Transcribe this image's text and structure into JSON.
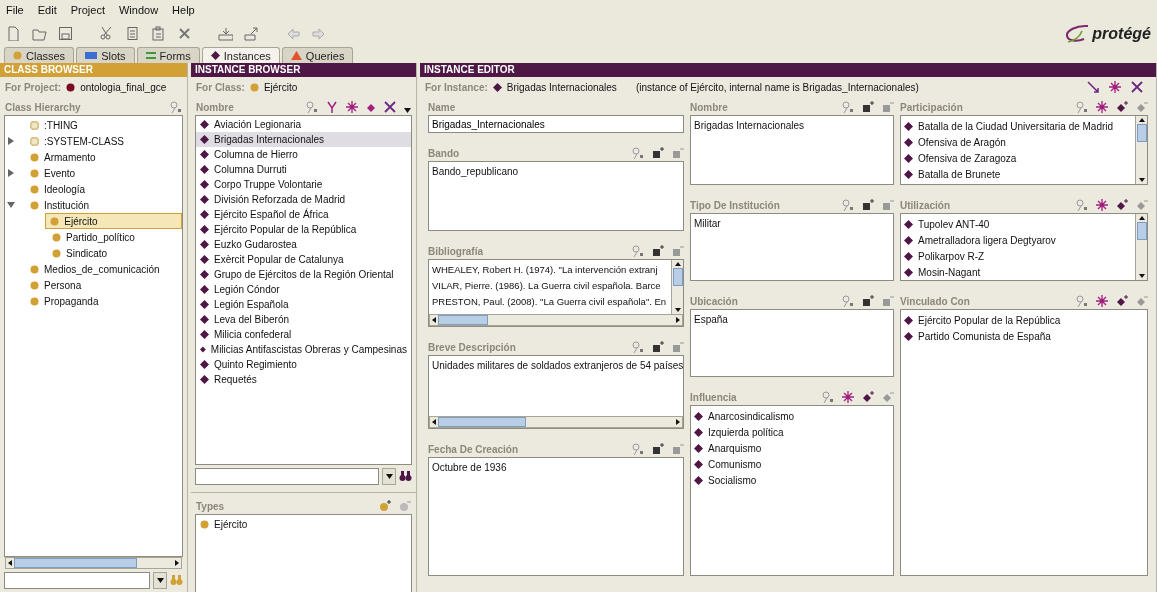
{
  "menu": [
    "File",
    "Edit",
    "Project",
    "Window",
    "Help"
  ],
  "logo": "protégé",
  "tabs": [
    {
      "label": "Classes",
      "kind": "class",
      "selected": false
    },
    {
      "label": "Slots",
      "kind": "slot",
      "selected": false
    },
    {
      "label": "Forms",
      "kind": "form",
      "selected": false
    },
    {
      "label": "Instances",
      "kind": "instance",
      "selected": true
    },
    {
      "label": "Queries",
      "kind": "query",
      "selected": false
    }
  ],
  "class_browser": {
    "title": "CLASS BROWSER",
    "project_label": "For Project:",
    "project": "ontologia_final_gce",
    "hierarchy_label": "Class Hierarchy",
    "tree": [
      {
        "label": ":THING",
        "kind": "system",
        "selected": false
      },
      {
        "label": ":SYSTEM-CLASS",
        "kind": "system",
        "expanded": false,
        "selected": false
      },
      {
        "label": "Armamento",
        "kind": "class",
        "selected": false
      },
      {
        "label": "Evento",
        "kind": "class",
        "expanded": false,
        "selected": false
      },
      {
        "label": "Ideología",
        "kind": "class",
        "selected": false
      },
      {
        "label": "Institución",
        "kind": "class",
        "expanded": true,
        "selected": false,
        "children": [
          {
            "label": "Ejército",
            "kind": "class",
            "selected": true
          },
          {
            "label": "Partido_político",
            "kind": "class",
            "selected": false
          },
          {
            "label": "Sindicato",
            "kind": "class",
            "selected": false
          }
        ]
      },
      {
        "label": "Medios_de_comunicación",
        "kind": "class",
        "selected": false
      },
      {
        "label": "Persona",
        "kind": "class",
        "selected": false
      },
      {
        "label": "Propaganda",
        "kind": "class",
        "selected": false
      }
    ]
  },
  "instance_browser": {
    "title": "INSTANCE BROWSER",
    "class_label": "For Class:",
    "class": "Ejército",
    "list_label": "Nombre",
    "instances": [
      {
        "label": "Aviación Legionaria",
        "selected": false
      },
      {
        "label": "Brigadas Internacionales",
        "selected": true
      },
      {
        "label": "Columna de Hierro",
        "selected": false
      },
      {
        "label": "Columna Durruti",
        "selected": false
      },
      {
        "label": "Corpo Truppe Volontarie",
        "selected": false
      },
      {
        "label": "División Reforzada de Madrid",
        "selected": false
      },
      {
        "label": "Ejército Español de África",
        "selected": false
      },
      {
        "label": "Ejército Popular de la República",
        "selected": false
      },
      {
        "label": "Euzko Gudarostea",
        "selected": false
      },
      {
        "label": "Exèrcit Popular de Catalunya",
        "selected": false
      },
      {
        "label": "Grupo de Ejércitos de la Región Oriental",
        "selected": false
      },
      {
        "label": "Legión Cóndor",
        "selected": false
      },
      {
        "label": "Legión Española",
        "selected": false
      },
      {
        "label": "Leva del Biberón",
        "selected": false
      },
      {
        "label": "Milicia confederal",
        "selected": false
      },
      {
        "label": "Milicias Antifascistas Obreras y Campesinas",
        "selected": false
      },
      {
        "label": "Quinto Regimiento",
        "selected": false
      },
      {
        "label": "Requetés",
        "selected": false
      }
    ],
    "types_label": "Types",
    "types": [
      "Ejército"
    ]
  },
  "instance_editor": {
    "title": "INSTANCE EDITOR",
    "instance_label": "For Instance:",
    "instance": "Brigadas Internacionales",
    "note": "(instance of Ejército, internal name is Brigadas_Internacionales)",
    "columns": [
      {
        "slots": [
          {
            "label": "Name",
            "kind": "name",
            "values": [
              "Brigadas_Internacionales"
            ]
          },
          {
            "label": "Bando",
            "kind": "text",
            "values": [
              "Bando_republicano"
            ]
          },
          {
            "label": "Bibliografía",
            "kind": "text",
            "values": [
              "WHEALEY, Robert H. (1974). \"La intervención extranj",
              "VILAR, Pierre. (1986). La Guerra civil española. Barce",
              "PRESTON, Paul. (2008). \"La Guerra civil española\". En"
            ]
          },
          {
            "label": "Breve Descripción",
            "kind": "text",
            "values": [
              "Unidades militares de soldados extranjeros de 54 países"
            ]
          },
          {
            "label": "Fecha De Creación",
            "kind": "text",
            "values": [
              "Octubre de 1936"
            ]
          }
        ]
      },
      {
        "slots": [
          {
            "label": "Nombre",
            "kind": "text",
            "values": [
              "Brigadas Internacionales"
            ]
          },
          {
            "label": "Tipo De Institución",
            "kind": "text",
            "values": [
              "Militar"
            ]
          },
          {
            "label": "Ubicación",
            "kind": "text",
            "values": [
              "España"
            ]
          },
          {
            "label": "Influencia",
            "kind": "instance",
            "values": [
              "Anarcosindicalismo",
              "Izquierda política",
              "Anarquismo",
              "Comunismo",
              "Socialismo"
            ]
          }
        ]
      },
      {
        "slots": [
          {
            "label": "Participación",
            "kind": "instance",
            "values": [
              "Batalla de la Ciudad Universitaria de Madrid",
              "Ofensiva de Aragón",
              "Ofensiva de Zaragoza",
              "Batalla de Brunete"
            ]
          },
          {
            "label": "Utilización",
            "kind": "instance",
            "values": [
              "Tupolev ANT-40",
              "Ametralladora ligera Degtyarov",
              "Polikarpov R-Z",
              "Mosin-Nagant"
            ]
          },
          {
            "label": "Vinculado Con",
            "kind": "instance",
            "values": [
              "Ejército Popular de la República",
              "Partido Comunista de España"
            ]
          }
        ]
      }
    ]
  }
}
